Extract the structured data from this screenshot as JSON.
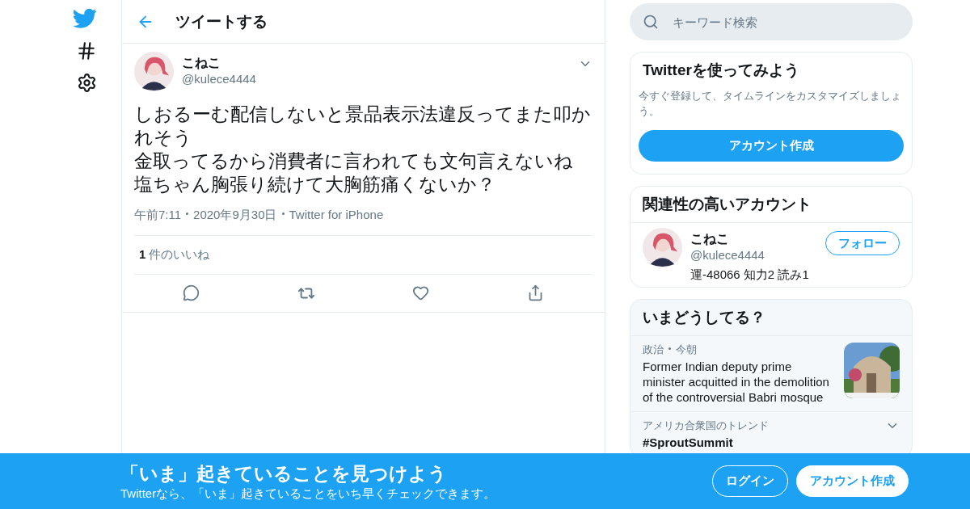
{
  "header": {
    "title": "ツイートする"
  },
  "tweet": {
    "name": "こねこ",
    "handle": "@kulece4444",
    "lines": [
      "しおるーむ配信しないと景品表示法違反ってまた叩かれそう",
      "金取ってるから消費者に言われても文句言えないね",
      "塩ちゃん胸張り続けて大胸筋痛くないか？"
    ],
    "meta": [
      "午前7:11",
      "2020年9月30日",
      "Twitter for iPhone"
    ],
    "like_count": "1",
    "like_label": "件のいいね"
  },
  "search": {
    "placeholder": "キーワード検索"
  },
  "signup_card": {
    "title": "Twitterを使ってみよう",
    "text": "今すぐ登録して、タイムラインをカスタマイズしましょう。",
    "button": "アカウント作成"
  },
  "related": {
    "title": "関連性の高いアカウント",
    "accounts": [
      {
        "name": "こねこ",
        "handle": "@kulece4444",
        "bio": "運-48066 知力2 読み1",
        "button": "フォロー"
      }
    ]
  },
  "trends": {
    "title": "いまどうしてる？",
    "items": [
      {
        "kind": "news",
        "context": [
          "政治",
          "今朝"
        ],
        "text": "Former Indian deputy prime minister acquitted in the demolition of the controversial Babri mosque"
      },
      {
        "kind": "trend",
        "context": [
          "アメリカ合衆国のトレンド"
        ],
        "text": "#SproutSummit"
      }
    ]
  },
  "bottom_bar": {
    "title": "「いま」起きていることを見つけよう",
    "subtitle": "Twitterなら、「いま」起きていることをいち早くチェックできます。",
    "buttons": [
      {
        "label": "ログイン",
        "kind": "outline"
      },
      {
        "label": "アカウント作成",
        "kind": "filled"
      }
    ]
  }
}
